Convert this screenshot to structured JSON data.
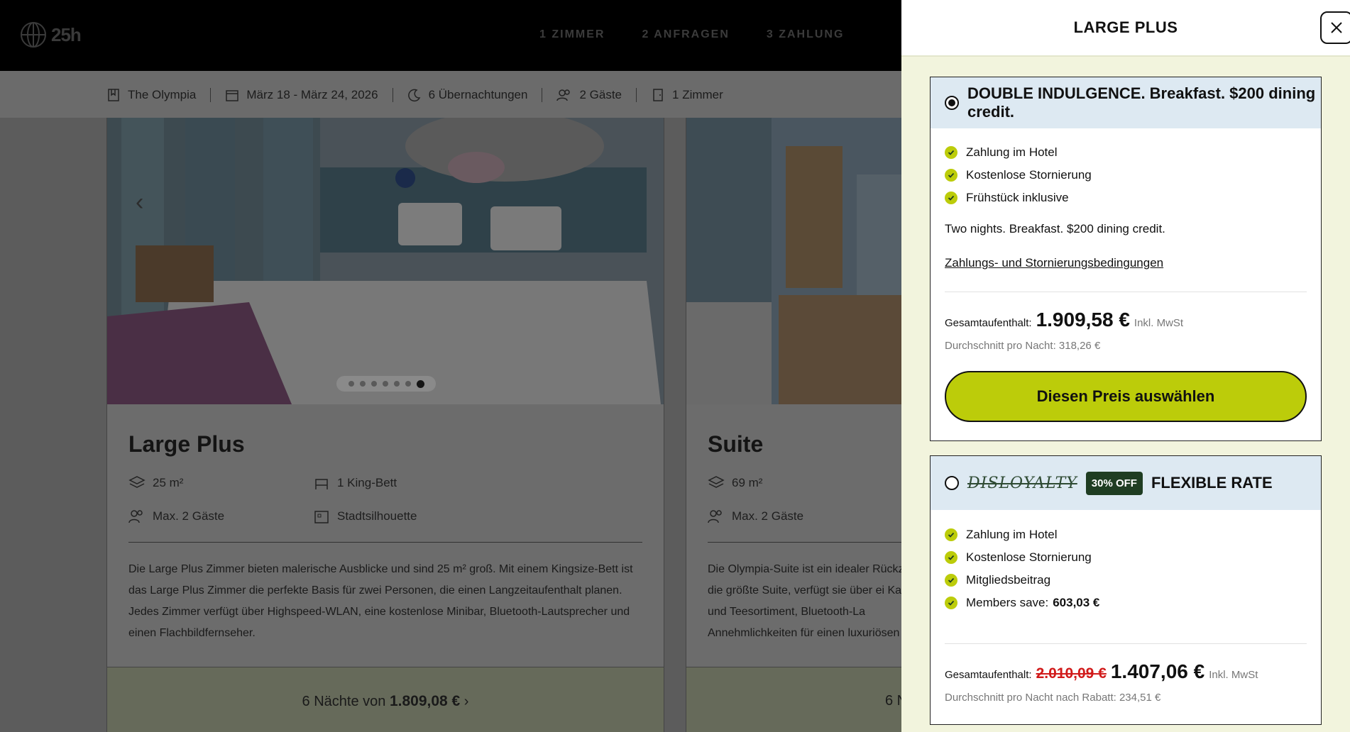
{
  "header": {
    "logo_text": "25h",
    "steps": [
      "1 ZIMMER",
      "2 ANFRAGEN",
      "3 ZAHLUNG"
    ]
  },
  "search": {
    "hotel": "The Olympia",
    "dates": "März 18 - März 24, 2026",
    "nights": "6 Übernachtungen",
    "guests": "2 Gäste",
    "rooms": "1 Zimmer"
  },
  "rooms": [
    {
      "title": "Large Plus",
      "size": "25 m²",
      "bed": "1 King-Bett",
      "max_guests": "Max. 2 Gäste",
      "view": "Stadtsilhouette",
      "description": "Die Large Plus Zimmer bieten malerische Ausblicke und sind 25 m² groß. Mit einem Kingsize-Bett ist das Large Plus Zimmer die perfekte Basis für zwei Personen, die einen Langzeitaufenthalt planen. Jedes Zimmer verfügt über Highspeed-WLAN, eine kostenlose Minibar, Bluetooth-Lautsprecher und einen Flachbildfernseher.",
      "footer_prefix": "6 Nächte von",
      "footer_price": "1.809,08 €",
      "slides": 7,
      "active_slide": 7
    },
    {
      "title": "Suite",
      "size": "69 m²",
      "max_guests": "Max. 2 Gäste",
      "description": "Die Olympia-Suite ist ein idealer Rückz m² die größte Suite, verfügt sie über ei Kaffee- und Teesortiment, Bluetooth-La Annehmlichkeiten für einen luxuriösen",
      "footer_prefix": "6 N"
    }
  ],
  "panel": {
    "title": "LARGE PLUS",
    "rates": [
      {
        "name": "DOUBLE INDULGENCE. Breakfast. $200 dining credit.",
        "selected": true,
        "features": [
          "Zahlung im Hotel",
          "Kostenlose Stornierung",
          "Frühstück inklusive"
        ],
        "description": "Two nights. Breakfast. $200 dining credit.",
        "terms_link": "Zahlungs- und Stornierungsbedingungen",
        "total_label": "Gesamtaufenthalt:",
        "total_price": "1.909,58 €",
        "tax_note": "Inkl. MwSt",
        "avg_label": "Durchschnitt pro Nacht: 318,26 €",
        "button_label": "Diesen Preis auswählen"
      },
      {
        "brand": "DISLOYALTY",
        "badge": "30% OFF",
        "name": "FLEXIBLE RATE",
        "selected": false,
        "features": [
          "Zahlung im Hotel",
          "Kostenlose Stornierung",
          "Mitgliedsbeitrag"
        ],
        "members_save_label": "Members save:",
        "members_save_value": "603,03 €",
        "total_label": "Gesamtaufenthalt:",
        "old_price": "2.010,09 €",
        "total_price": "1.407,06 €",
        "tax_note": "Inkl. MwSt",
        "avg_label": "Durchschnitt pro Nacht nach Rabatt: 234,51 €"
      }
    ]
  },
  "colors": {
    "accent": "#bccc0a",
    "badge_bg": "#1f3d22",
    "rate_header_bg": "#dde9f2",
    "panel_bg": "#f2f4dd",
    "strike_red": "#d11a1a"
  }
}
